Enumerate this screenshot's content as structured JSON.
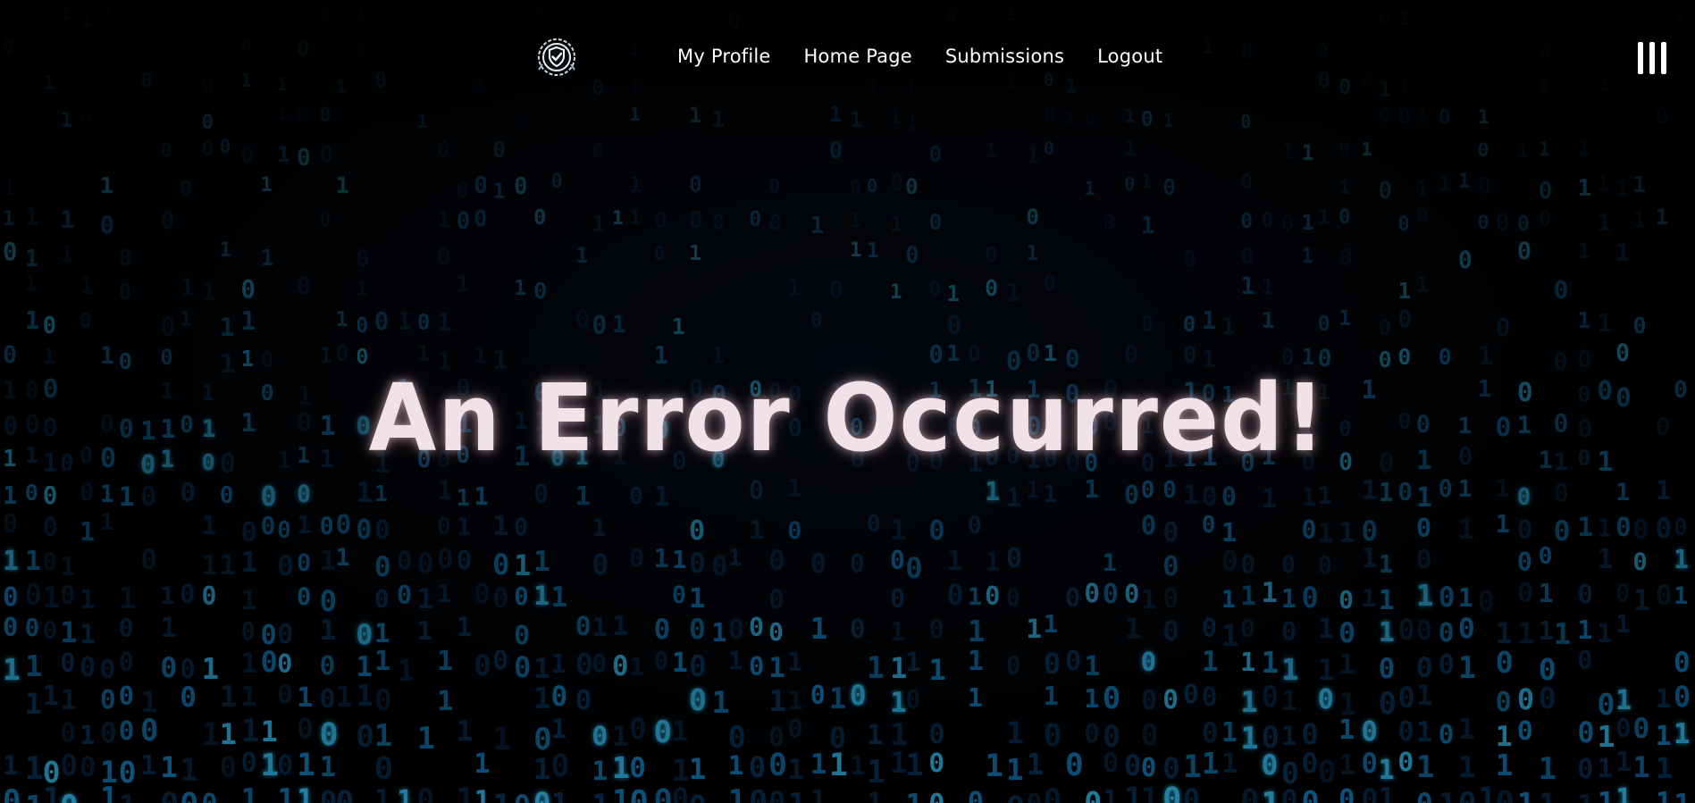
{
  "nav": {
    "logo_icon": "shield-check-gear-icon",
    "links": [
      {
        "label": "My Profile"
      },
      {
        "label": "Home Page"
      },
      {
        "label": "Submissions"
      },
      {
        "label": "Logout"
      }
    ],
    "menu_icon": "hamburger-menu-icon"
  },
  "hero": {
    "title": "An Error Occurred!"
  },
  "colors": {
    "background": "#000000",
    "binary_rain": "#1fa3e6",
    "title": "#f1e2e8",
    "nav_text": "#ffffff"
  }
}
